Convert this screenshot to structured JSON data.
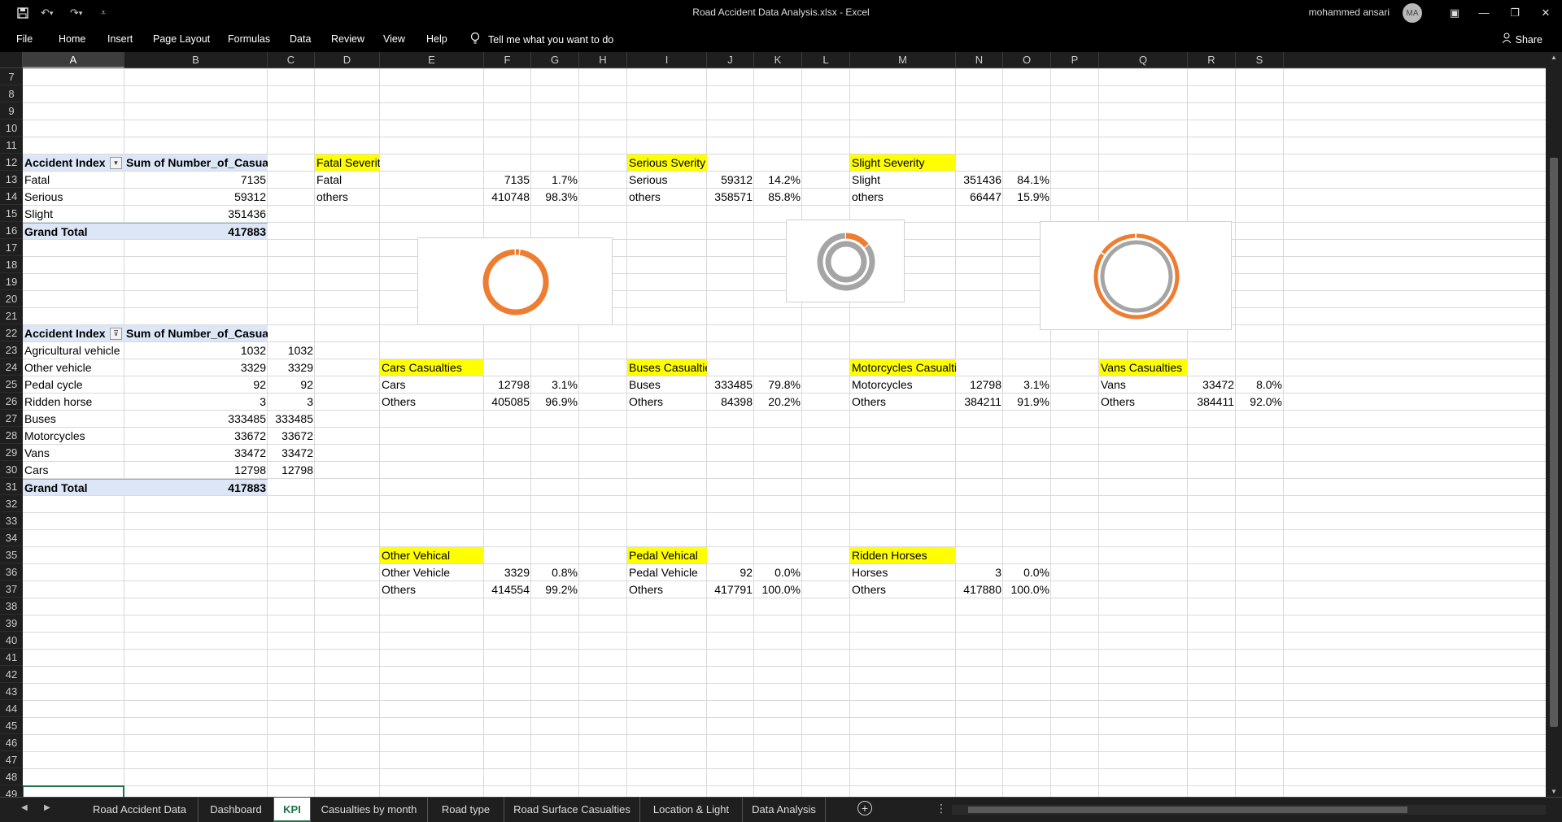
{
  "titlebar": {
    "title": "Road Accident Data Analysis.xlsx  -  Excel",
    "user": "mohammed ansari",
    "avatar_initials": "MA",
    "save_icon": "save-icon",
    "undo_icon": "undo-icon",
    "redo_icon": "redo-icon"
  },
  "ribbon": {
    "tabs": [
      "File",
      "Home",
      "Insert",
      "Page Layout",
      "Formulas",
      "Data",
      "Review",
      "View",
      "Help"
    ],
    "tell_me": "Tell me what you want to do",
    "share": "Share"
  },
  "columns": [
    "A",
    "B",
    "C",
    "D",
    "E",
    "F",
    "G",
    "H",
    "I",
    "J",
    "K",
    "L",
    "M",
    "N",
    "O",
    "P",
    "Q",
    "R",
    "S"
  ],
  "rows": [
    "7",
    "8",
    "9",
    "10",
    "11",
    "12",
    "13",
    "14",
    "15",
    "16",
    "17",
    "18",
    "19",
    "20",
    "21",
    "22",
    "23",
    "24",
    "25",
    "26",
    "27",
    "28",
    "29",
    "30",
    "31",
    "32",
    "33",
    "34",
    "35",
    "36",
    "37",
    "38",
    "39",
    "40",
    "41",
    "42",
    "43",
    "44",
    "45",
    "46",
    "47",
    "48",
    "49"
  ],
  "pivot1": {
    "header_a": "Accident Index",
    "header_b": "Sum of Number_of_Casualties",
    "rows": [
      {
        "label": "Fatal",
        "value": "7135"
      },
      {
        "label": "Serious",
        "value": "59312"
      },
      {
        "label": "Slight",
        "value": "351436"
      }
    ],
    "total_label": "Grand Total",
    "total_value": "417883"
  },
  "pivot2": {
    "header_a": "Accident Index",
    "header_b": "Sum of Number_of_Casualties",
    "rows": [
      {
        "label": "Agricultural vehicle",
        "value": "1032",
        "c": "1032"
      },
      {
        "label": "Other vehicle",
        "value": "3329",
        "c": "3329"
      },
      {
        "label": "Pedal cycle",
        "value": "92",
        "c": "92"
      },
      {
        "label": "Ridden horse",
        "value": "3",
        "c": "3"
      },
      {
        "label": "Buses",
        "value": "333485",
        "c": "333485"
      },
      {
        "label": "Motorcycles",
        "value": "33672",
        "c": "33672"
      },
      {
        "label": "Vans",
        "value": "33472",
        "c": "33472"
      },
      {
        "label": "Cars",
        "value": "12798",
        "c": "12798"
      }
    ],
    "total_label": "Grand Total",
    "total_value": "417883"
  },
  "kpis": {
    "fatal": {
      "title": "Fatal Severity",
      "r1": [
        "Fatal",
        "7135",
        "1.7%"
      ],
      "r2": [
        "others",
        "410748",
        "98.3%"
      ]
    },
    "serious": {
      "title": "Serious Sverity",
      "r1": [
        "Serious",
        "59312",
        "14.2%"
      ],
      "r2": [
        "others",
        "358571",
        "85.8%"
      ]
    },
    "slight": {
      "title": "Slight Severity",
      "r1": [
        "Slight",
        "351436",
        "84.1%"
      ],
      "r2": [
        "others",
        "66447",
        "15.9%"
      ]
    },
    "cars": {
      "title": "Cars Casualties",
      "r1": [
        "Cars",
        "12798",
        "3.1%"
      ],
      "r2": [
        "Others",
        "405085",
        "96.9%"
      ]
    },
    "buses": {
      "title": "Buses Casualties",
      "r1": [
        "Buses",
        "333485",
        "79.8%"
      ],
      "r2": [
        "Others",
        "84398",
        "20.2%"
      ]
    },
    "motorcycles": {
      "title": "Motorcycles Casualties",
      "r1": [
        "Motorcycles",
        "12798",
        "3.1%"
      ],
      "r2": [
        "Others",
        "384211",
        "91.9%"
      ]
    },
    "vans": {
      "title": "Vans Casualties",
      "r1": [
        "Vans",
        "33472",
        "8.0%"
      ],
      "r2": [
        "Others",
        "384411",
        "92.0%"
      ]
    },
    "other": {
      "title": "Other Vehical",
      "r1": [
        "Other Vehicle",
        "3329",
        "0.8%"
      ],
      "r2": [
        "Others",
        "414554",
        "99.2%"
      ]
    },
    "pedal": {
      "title": "Pedal Vehical",
      "r1": [
        "Pedal Vehicle",
        "92",
        "0.0%"
      ],
      "r2": [
        "Others",
        "417791",
        "100.0%"
      ]
    },
    "horses": {
      "title": "Ridden Horses",
      "r1": [
        "Horses",
        "3",
        "0.0%"
      ],
      "r2": [
        "Others",
        "417880",
        "100.0%"
      ]
    }
  },
  "charts": {
    "fatal": {
      "highlight_fraction": 0.017,
      "colors": {
        "main": "#ed7d31",
        "other": "#a5a5a5"
      }
    },
    "serious": {
      "highlight_fraction": 0.142,
      "colors": {
        "main": "#a5a5a5",
        "other": "#ed7d31"
      }
    },
    "slight": {
      "highlight_fraction": 0.841,
      "colors": {
        "main": "#ed7d31",
        "other": "#a5a5a5"
      }
    }
  },
  "sheet_tabs": [
    "Road Accident Data",
    "Dashboard",
    "KPI",
    "Casualties by month",
    "Road type",
    "Road Surface Casualties",
    "Location & Light",
    "Data Analysis"
  ],
  "active_sheet": "KPI"
}
